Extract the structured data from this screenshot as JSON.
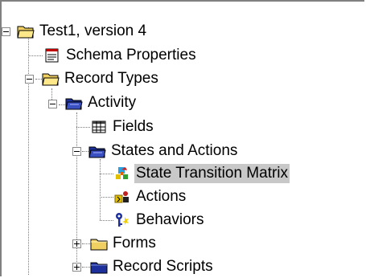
{
  "tree": {
    "root": {
      "label": "Test1, version 4",
      "icon": "open-folder-icon",
      "expanded": true
    },
    "schema_properties": {
      "label": "Schema Properties",
      "icon": "properties-sheet-icon"
    },
    "record_types": {
      "label": "Record Types",
      "icon": "open-folder-icon",
      "expanded": true
    },
    "activity": {
      "label": "Activity",
      "icon": "open-blue-folder-icon",
      "expanded": true
    },
    "fields": {
      "label": "Fields",
      "icon": "fields-grid-icon"
    },
    "states_and_actions": {
      "label": "States and Actions",
      "icon": "open-blue-folder-icon",
      "expanded": true
    },
    "state_transition_matrix": {
      "label": "State Transition Matrix",
      "icon": "state-matrix-icon",
      "selected": true
    },
    "actions": {
      "label": "Actions",
      "icon": "actions-icon"
    },
    "behaviors": {
      "label": "Behaviors",
      "icon": "behaviors-key-icon"
    },
    "forms": {
      "label": "Forms",
      "icon": "yellow-folder-icon",
      "expanded": false
    },
    "record_scripts": {
      "label": "Record Scripts",
      "icon": "blue-folder-icon",
      "expanded": false
    }
  },
  "colors": {
    "folder_yellow": "#f0d060",
    "folder_blue": "#1c2f9a",
    "selection": "#c8c8c8",
    "tree_lines": "#7a7a7a"
  }
}
